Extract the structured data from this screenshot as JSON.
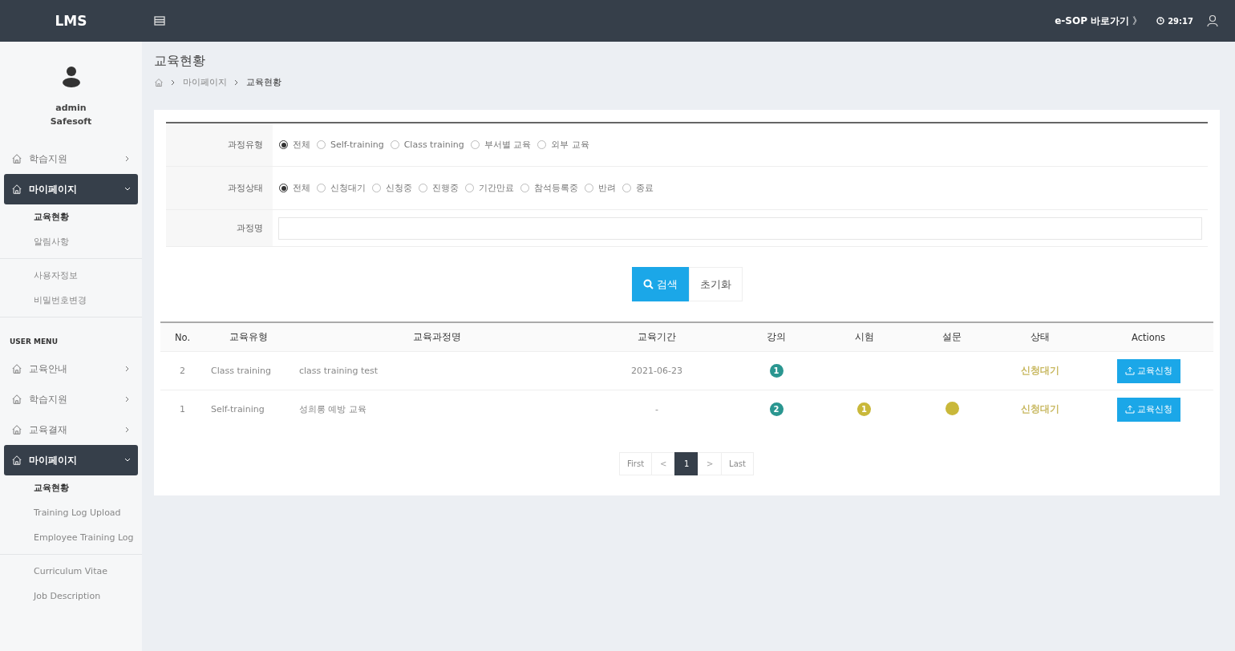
{
  "topbar": {
    "title": "LMS",
    "shortcut": "e-SOP 바로가기",
    "shortcut_arrow": "》",
    "timer": "29:17"
  },
  "sidebar": {
    "profile": {
      "name": "admin",
      "org": "Safesoft"
    },
    "groups": [
      {
        "items": [
          {
            "kind": "menu",
            "label": "학습지원",
            "expanded": false
          },
          {
            "kind": "menu",
            "label": "마이페이지",
            "expanded": true
          },
          {
            "kind": "sub",
            "label": "교육현황",
            "selected": true
          },
          {
            "kind": "sub",
            "label": "알림사항",
            "selected": false
          }
        ]
      },
      {
        "items": [
          {
            "kind": "sub",
            "label": "사용자정보",
            "selected": false
          },
          {
            "kind": "sub",
            "label": "비밀번호변경",
            "selected": false
          }
        ]
      },
      {
        "heading": "USER MENU",
        "items": [
          {
            "kind": "menu",
            "label": "교육안내",
            "expanded": false
          },
          {
            "kind": "menu",
            "label": "학습지원",
            "expanded": false
          },
          {
            "kind": "menu",
            "label": "교육결재",
            "expanded": false
          },
          {
            "kind": "menu",
            "label": "마이페이지",
            "expanded": true
          },
          {
            "kind": "sub",
            "label": "교육현황",
            "selected": true
          },
          {
            "kind": "sub",
            "label": "Training Log Upload",
            "selected": false
          },
          {
            "kind": "sub",
            "label": "Employee Training Log",
            "selected": false
          }
        ]
      },
      {
        "items": [
          {
            "kind": "sub",
            "label": "Curriculum Vitae",
            "selected": false
          },
          {
            "kind": "sub",
            "label": "Job Description",
            "selected": false
          }
        ]
      }
    ]
  },
  "page": {
    "title": "교육현황",
    "breadcrumb": [
      "마이페이지",
      "교육현황"
    ]
  },
  "filter": {
    "rows": [
      {
        "kind": "radio",
        "label": "과정유형",
        "options": [
          {
            "label": "전체",
            "selected": true
          },
          {
            "label": "Self-training",
            "selected": false
          },
          {
            "label": "Class training",
            "selected": false
          },
          {
            "label": "부서별 교육",
            "selected": false
          },
          {
            "label": "외부 교육",
            "selected": false
          }
        ]
      },
      {
        "kind": "radio",
        "label": "과정상태",
        "options": [
          {
            "label": "전체",
            "selected": true
          },
          {
            "label": "신청대기",
            "selected": false
          },
          {
            "label": "신청중",
            "selected": false
          },
          {
            "label": "진행중",
            "selected": false
          },
          {
            "label": "기간만료",
            "selected": false
          },
          {
            "label": "참석등록중",
            "selected": false
          },
          {
            "label": "반려",
            "selected": false
          },
          {
            "label": "종료",
            "selected": false
          }
        ]
      },
      {
        "kind": "text",
        "label": "과정명"
      }
    ],
    "search_button": "검색",
    "reset_button": "초기화"
  },
  "table": {
    "columns": [
      "No.",
      "교육유형",
      "교육과정명",
      "교육기간",
      "강의",
      "시험",
      "설문",
      "상태",
      "Actions"
    ],
    "rows": [
      {
        "no": "2",
        "type": "Class training",
        "name": "class training test",
        "period": "2021-06-23",
        "lecture": {
          "text": "1",
          "color": "#2a9690"
        },
        "status": {
          "text": "신청대기",
          "color": "#c8b860"
        },
        "action": "교육신청"
      },
      {
        "no": "1",
        "type": "Self-training",
        "name": "성희롱 예방 교육",
        "period": "-",
        "lecture": {
          "text": "2",
          "color": "#2a9690"
        },
        "exam": {
          "text": "1",
          "color": "#c9b83a"
        },
        "survey": {
          "color": "#c9b83a"
        },
        "status": {
          "text": "신청대기",
          "color": "#c8b860"
        },
        "action": "교육신청"
      }
    ]
  },
  "pager": [
    {
      "label": "First",
      "selected": false,
      "disabled": false
    },
    {
      "label": "<",
      "selected": false,
      "disabled": true
    },
    {
      "label": "1",
      "selected": true,
      "disabled": false
    },
    {
      "label": ">",
      "selected": false,
      "disabled": true
    },
    {
      "label": "Last",
      "selected": false,
      "disabled": false
    }
  ]
}
